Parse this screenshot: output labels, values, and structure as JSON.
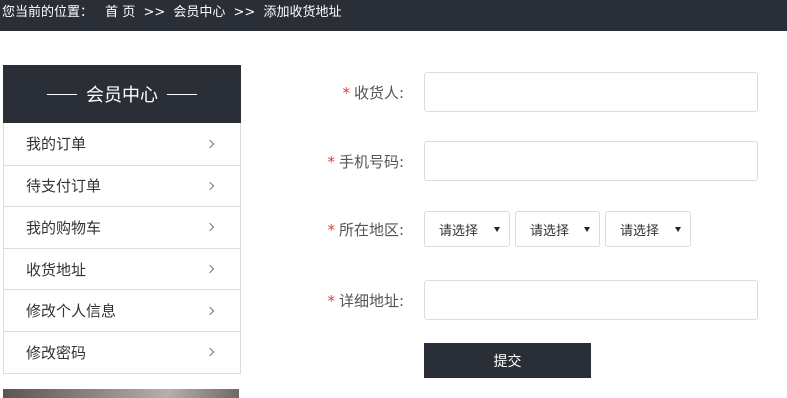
{
  "breadcrumb": {
    "label": "您当前的位置：",
    "items": [
      "首 页",
      "会员中心",
      "添加收货地址"
    ],
    "separator": ">>"
  },
  "sidebar": {
    "title": "会员中心",
    "items": [
      {
        "label": "我的订单"
      },
      {
        "label": "待支付订单"
      },
      {
        "label": "我的购物车"
      },
      {
        "label": "收货地址"
      },
      {
        "label": "修改个人信息"
      },
      {
        "label": "修改密码"
      }
    ]
  },
  "form": {
    "required_mark": "*",
    "recipient": {
      "label": "收货人:",
      "value": ""
    },
    "phone": {
      "label": "手机号码:",
      "value": ""
    },
    "region": {
      "label": "所在地区:",
      "province": "请选择",
      "city": "请选择",
      "district": "请选择"
    },
    "address": {
      "label": "详细地址:",
      "value": ""
    },
    "submit_label": "提交"
  },
  "colors": {
    "dark": "#2a2e37",
    "required": "#e23a3a"
  }
}
